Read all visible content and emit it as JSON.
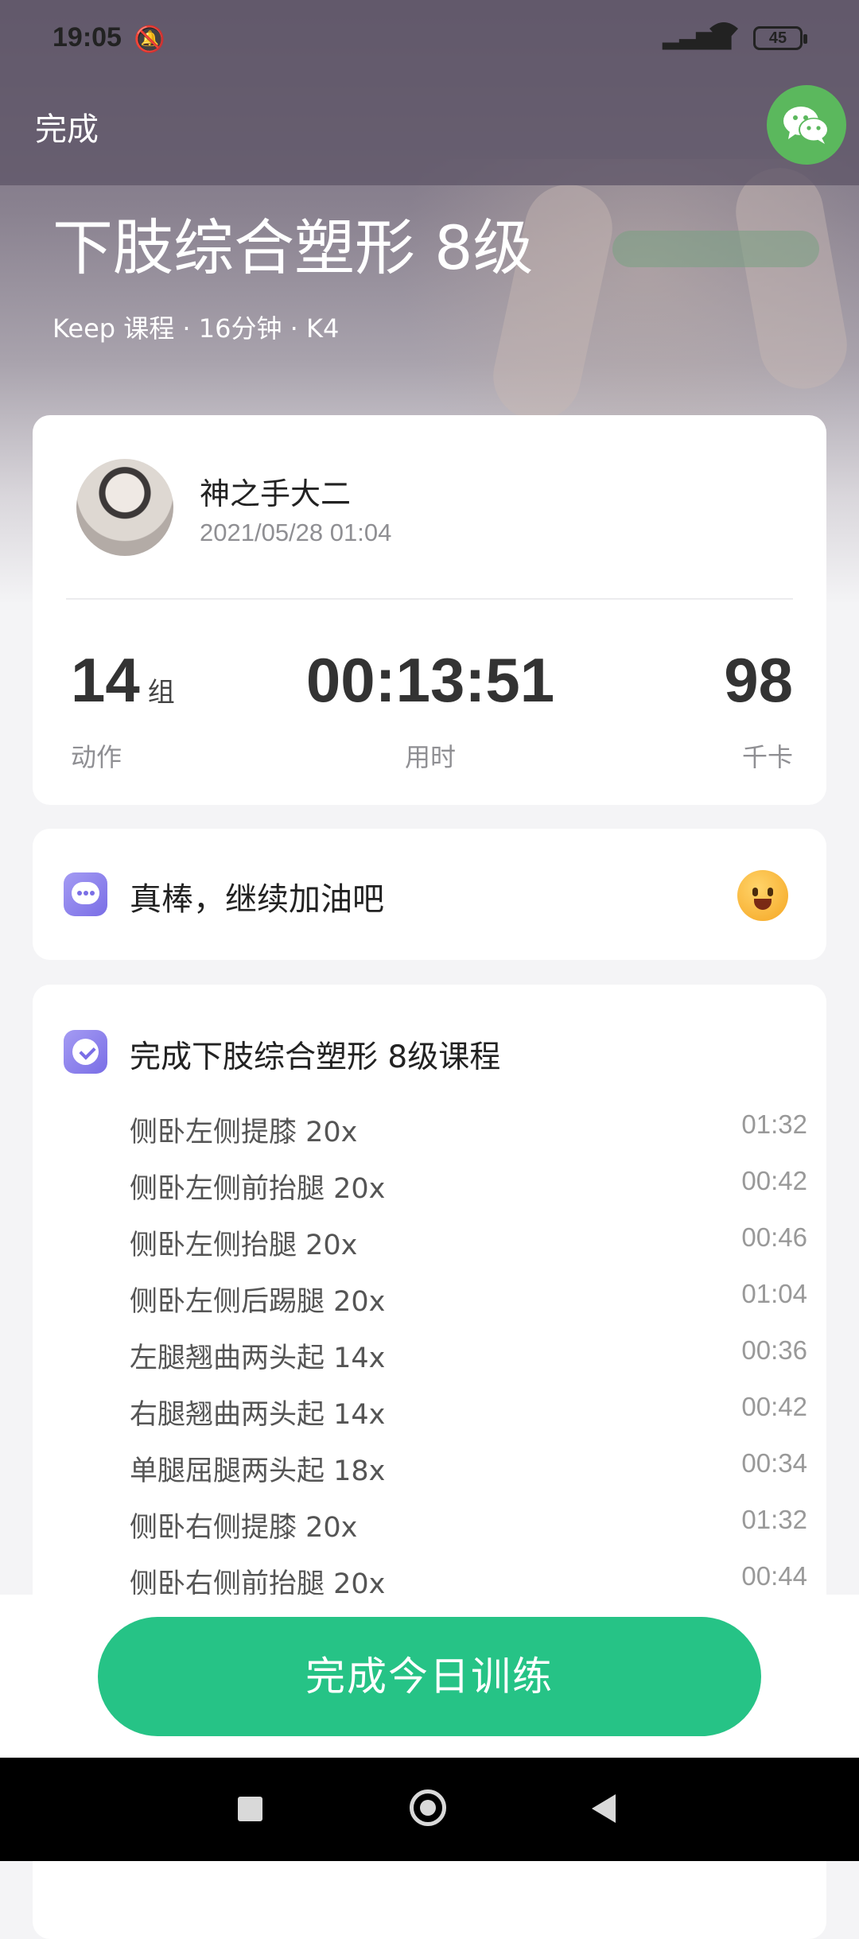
{
  "status_bar": {
    "time": "19:05",
    "battery": "45"
  },
  "header": {
    "done_label": "完成"
  },
  "course": {
    "title": "下肢综合塑形 8级",
    "subtitle": "Keep 课程 · 16分钟 · K4"
  },
  "user": {
    "name": "神之手大二",
    "date": "2021/05/28 01:04"
  },
  "stats": [
    {
      "value": "14",
      "unit": "组",
      "label": "动作"
    },
    {
      "value": "00:13:51",
      "unit": "",
      "label": "用时"
    },
    {
      "value": "98",
      "unit": "",
      "label": "千卡"
    }
  ],
  "cheer": {
    "text": "真棒，继续加油吧"
  },
  "completed": {
    "title": "完成下肢综合塑形 8级课程",
    "exercises": [
      {
        "name": "侧卧左侧提膝 20x",
        "time": "01:32"
      },
      {
        "name": "侧卧左侧前抬腿 20x",
        "time": "00:42"
      },
      {
        "name": "侧卧左侧抬腿 20x",
        "time": "00:46"
      },
      {
        "name": "侧卧左侧后踢腿 20x",
        "time": "01:04"
      },
      {
        "name": "左腿翘曲两头起 14x",
        "time": "00:36"
      },
      {
        "name": "右腿翘曲两头起 14x",
        "time": "00:42"
      },
      {
        "name": "单腿屈腿两头起 18x",
        "time": "00:34"
      },
      {
        "name": "侧卧右侧提膝 20x",
        "time": "01:32"
      },
      {
        "name": "侧卧右侧前抬腿 20x",
        "time": "00:44"
      }
    ]
  },
  "footer": {
    "finish_label": "完成今日训练"
  },
  "colors": {
    "accent": "#26c386",
    "wechat": "#5bb85d",
    "icon_purple": "#7a6ee6"
  }
}
